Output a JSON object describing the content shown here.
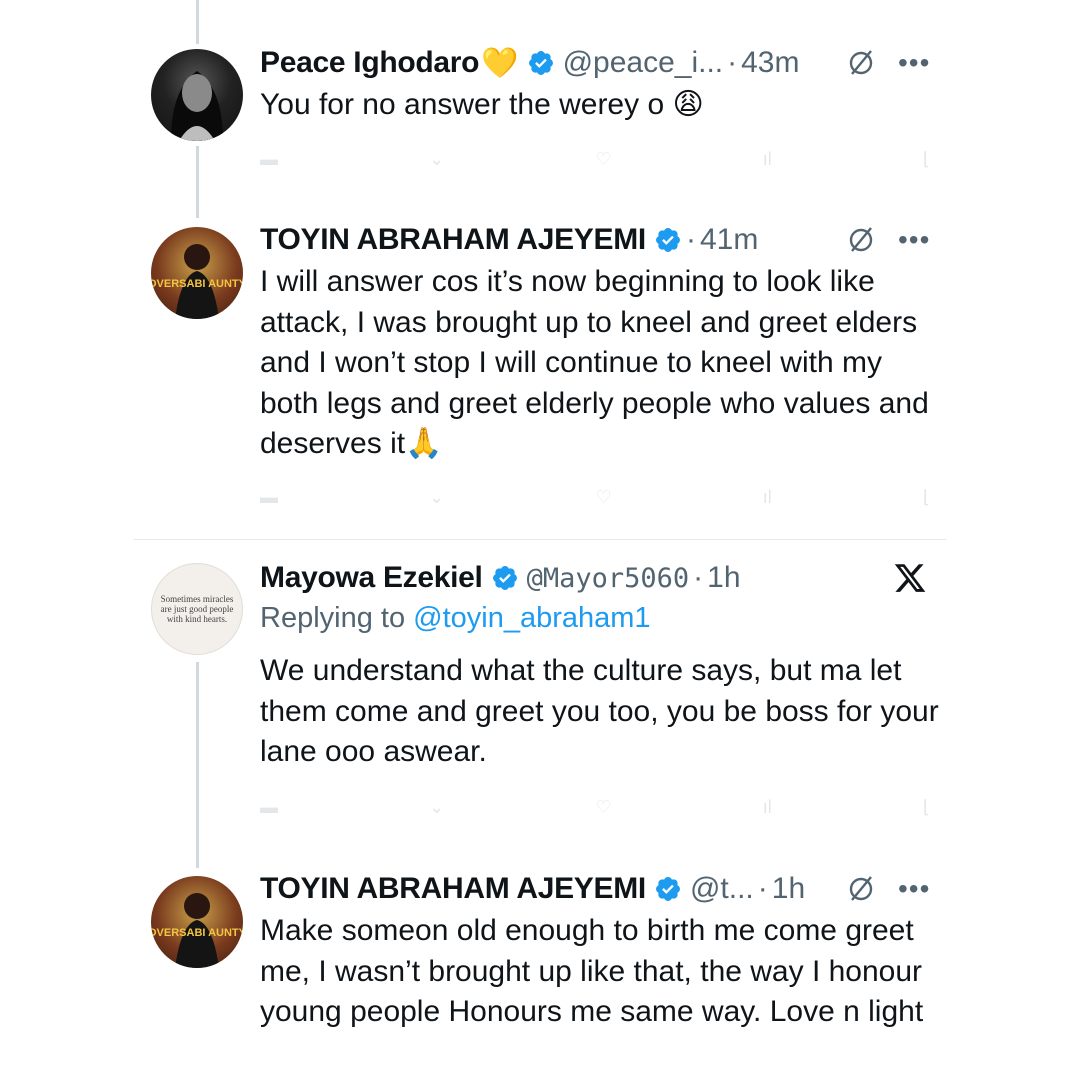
{
  "tweets": [
    {
      "name": "Peace Ighodaro",
      "emoji_after_name": "💛",
      "handle": "@peace_i...",
      "time": "43m",
      "text": "You for no answer the werey o 😩"
    },
    {
      "name": "TOYIN ABRAHAM AJEYEMI",
      "handle": "",
      "time": "41m",
      "text": "I will answer cos it’s now beginning to look like attack, I was brought up to kneel and greet elders and I won’t stop I will continue to kneel with my both legs and greet elderly people who values and deserves it🙏"
    },
    {
      "name": "Mayowa Ezekiel",
      "handle": "@Mayor5060",
      "time": "1h",
      "replying_label": "Replying to",
      "replying_handle": "@toyin_abraham1",
      "text": "We understand what the culture says, but ma let them come and greet you too, you be boss for your lane ooo aswear.",
      "avatar_text": "Sometimes miracles are just good people with kind hearts."
    },
    {
      "name": "TOYIN ABRAHAM AJEYEMI",
      "handle": "@t...",
      "time": "1h",
      "text": "Make someon old enough to birth me come greet me, I wasn’t brought up like that, the way I honour young people Honours me same way. Love n light"
    }
  ],
  "separator": "·",
  "more_label": "•••",
  "toyin_avatar_text": "OVERSABI AUNTY",
  "colors": {
    "verified": "#1d9bf0",
    "muted": "#536471",
    "link": "#1d9bf0",
    "line": "#cfd9de"
  }
}
